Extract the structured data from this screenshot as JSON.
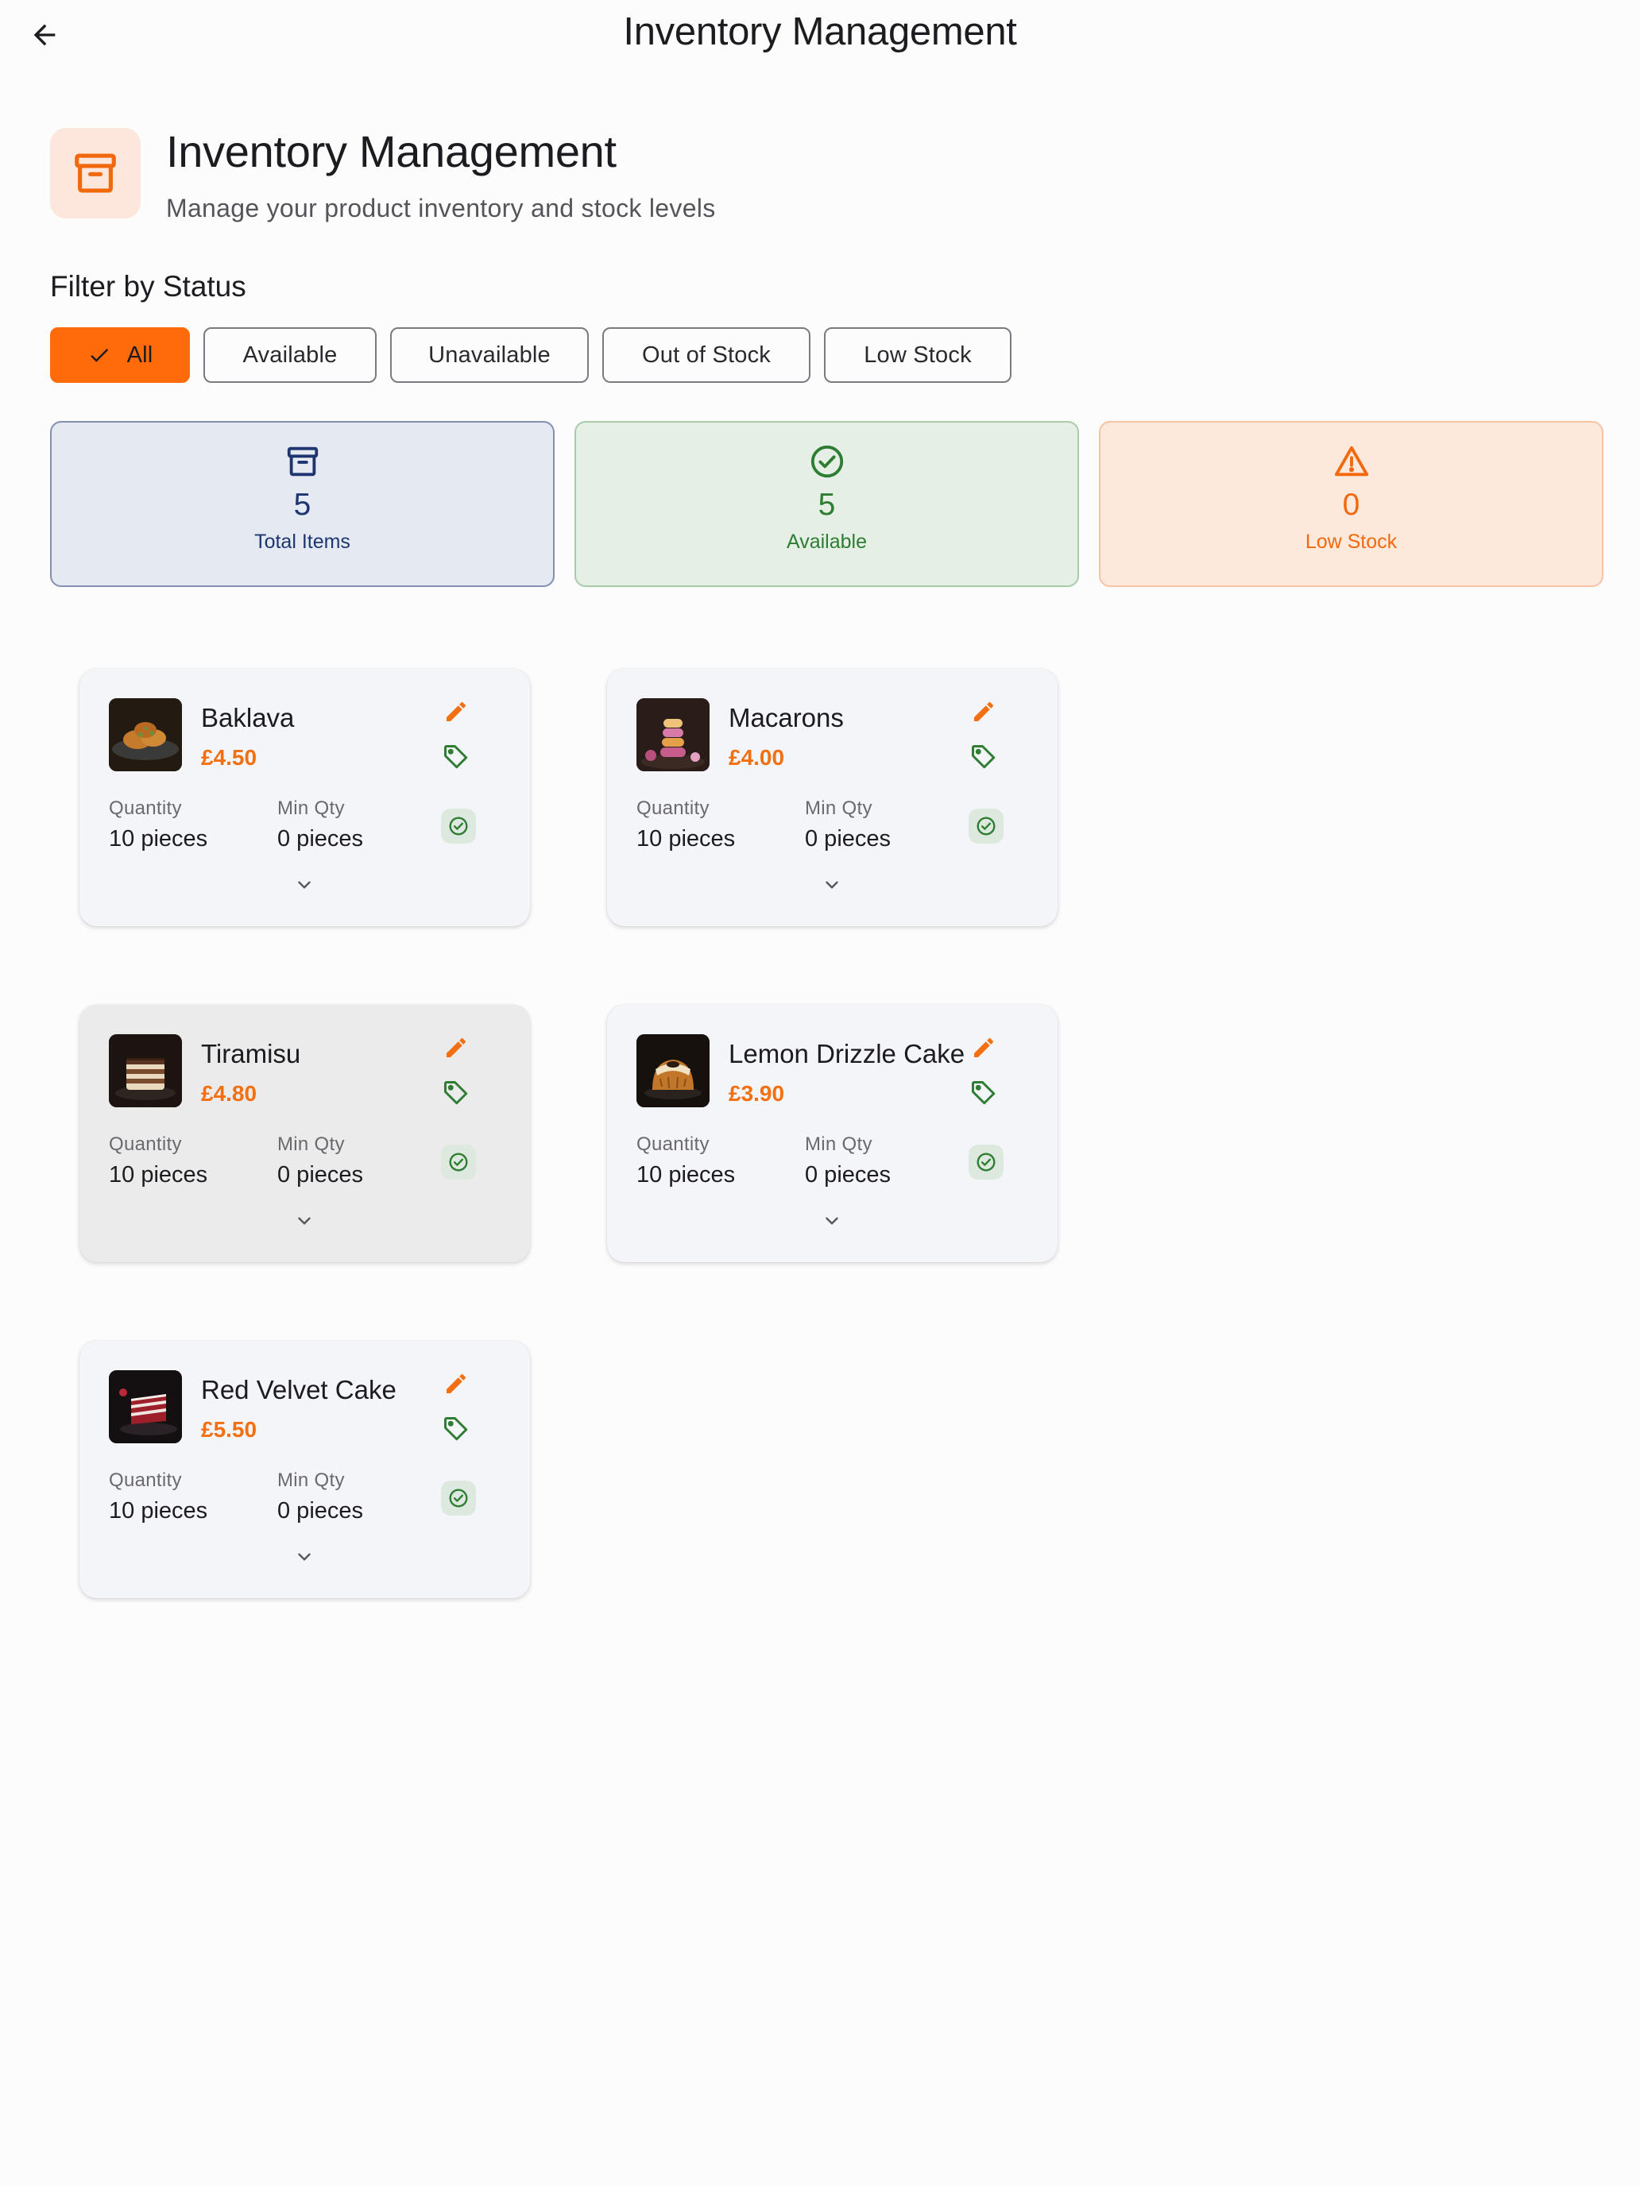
{
  "appbar": {
    "title": "Inventory Management"
  },
  "header": {
    "title": "Inventory Management",
    "subtitle": "Manage your product inventory and stock levels"
  },
  "filter": {
    "label": "Filter by Status",
    "chips": [
      {
        "label": "All",
        "selected": true
      },
      {
        "label": "Available",
        "selected": false
      },
      {
        "label": "Unavailable",
        "selected": false
      },
      {
        "label": "Out of Stock",
        "selected": false
      },
      {
        "label": "Low Stock",
        "selected": false
      }
    ]
  },
  "stats": [
    {
      "value": "5",
      "label": "Total Items",
      "icon": "archive-icon",
      "color": "#1e3570"
    },
    {
      "value": "5",
      "label": "Available",
      "icon": "check-circle-icon",
      "color": "#2e7d32"
    },
    {
      "value": "0",
      "label": "Low Stock",
      "icon": "warning-icon",
      "color": "#f2690d"
    }
  ],
  "labels": {
    "quantity": "Quantity",
    "min_qty": "Min Qty"
  },
  "products": [
    {
      "name": "Baklava",
      "price": "£4.50",
      "quantity": "10 pieces",
      "min_qty": "0 pieces",
      "status": "available"
    },
    {
      "name": "Macarons",
      "price": "£4.00",
      "quantity": "10 pieces",
      "min_qty": "0 pieces",
      "status": "available"
    },
    {
      "name": "Tiramisu",
      "price": "£4.80",
      "quantity": "10 pieces",
      "min_qty": "0 pieces",
      "status": "available"
    },
    {
      "name": "Lemon Drizzle Cake",
      "price": "£3.90",
      "quantity": "10 pieces",
      "min_qty": "0 pieces",
      "status": "available"
    },
    {
      "name": "Red Velvet Cake",
      "price": "£5.50",
      "quantity": "10 pieces",
      "min_qty": "0 pieces",
      "status": "available"
    }
  ],
  "colors": {
    "accent": "#ff6a0a",
    "price": "#f26f12",
    "available": "#2e7d32",
    "primary": "#1e3570"
  }
}
